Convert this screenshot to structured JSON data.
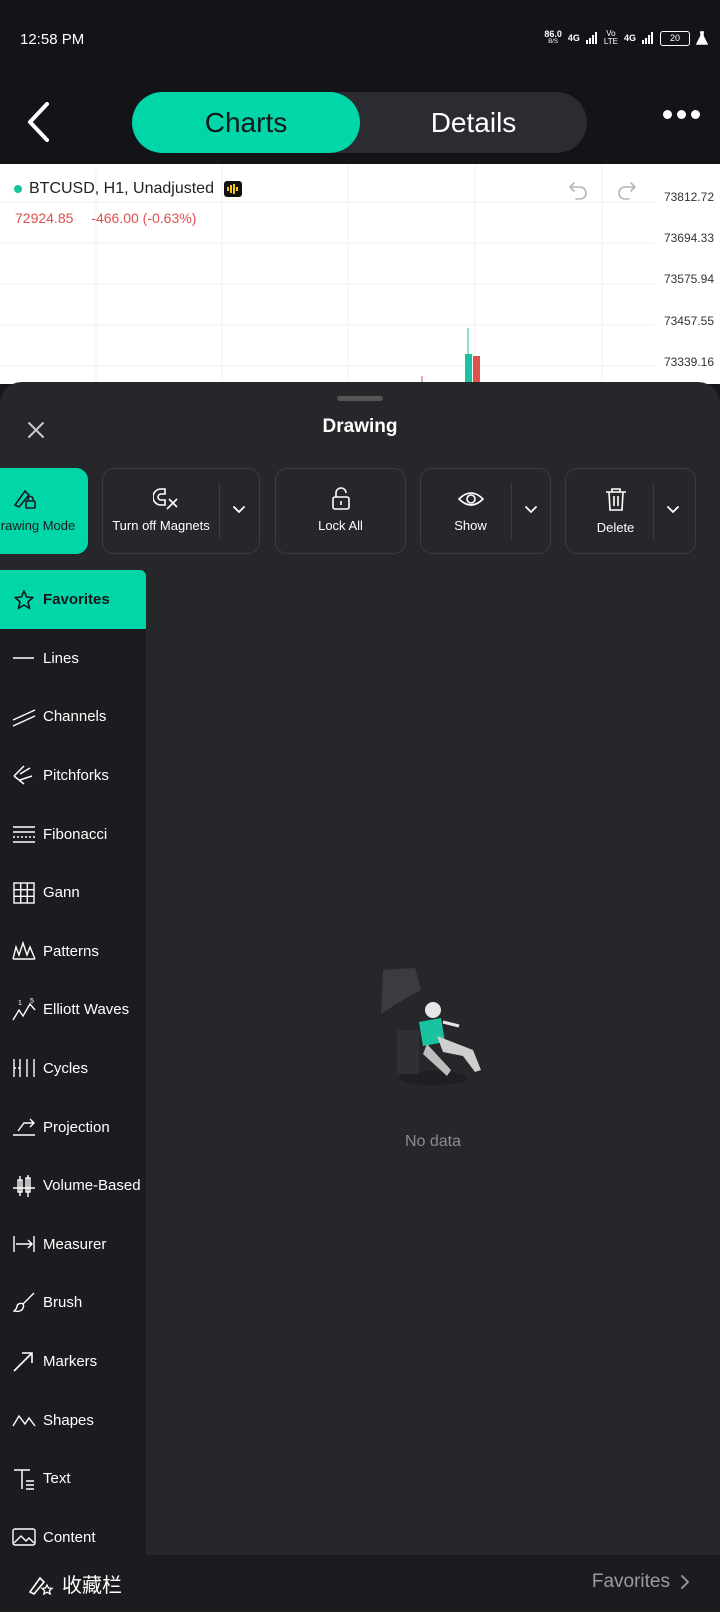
{
  "status": {
    "time": "12:58 PM",
    "speed": "86.0",
    "speed_unit": "B/S",
    "net1": "4G",
    "volte_top": "Vo",
    "volte_bottom": "LTE",
    "net2": "4G",
    "battery": "20"
  },
  "header": {
    "tabs": [
      {
        "label": "Charts",
        "active": true
      },
      {
        "label": "Details",
        "active": false
      }
    ]
  },
  "chart": {
    "symbol": "BTCUSD, H1, Unadjusted",
    "price": "72924.85",
    "change": "-466.00 (-0.63%)",
    "axis_labels": [
      "73812.72",
      "73694.33",
      "73575.94",
      "73457.55",
      "73339.16"
    ],
    "colors": {
      "up": "#19c3a0",
      "down": "#e0504d"
    }
  },
  "panel": {
    "title": "Drawing",
    "tools": [
      {
        "label": "rawing Mode",
        "icon": "drawing-mode-icon",
        "active": true
      },
      {
        "label": "Turn off Magnets",
        "icon": "magnet-off-icon",
        "dropdown": true
      },
      {
        "label": "Lock All",
        "icon": "lock-icon"
      },
      {
        "label": "Show",
        "icon": "eye-icon",
        "dropdown": true
      },
      {
        "label": "Delete",
        "icon": "trash-icon",
        "dropdown": true
      }
    ],
    "categories": [
      {
        "label": "Favorites",
        "icon": "star-icon",
        "active": true
      },
      {
        "label": "Lines",
        "icon": "line-icon"
      },
      {
        "label": "Channels",
        "icon": "channel-icon"
      },
      {
        "label": "Pitchforks",
        "icon": "pitchfork-icon"
      },
      {
        "label": "Fibonacci",
        "icon": "fibonacci-icon"
      },
      {
        "label": "Gann",
        "icon": "gann-icon"
      },
      {
        "label": "Patterns",
        "icon": "patterns-icon"
      },
      {
        "label": "Elliott Waves",
        "icon": "elliott-waves-icon"
      },
      {
        "label": "Cycles",
        "icon": "cycles-icon"
      },
      {
        "label": "Projection",
        "icon": "projection-icon"
      },
      {
        "label": "Volume-Based",
        "icon": "volume-icon"
      },
      {
        "label": "Measurer",
        "icon": "measurer-icon"
      },
      {
        "label": "Brush",
        "icon": "brush-icon"
      },
      {
        "label": "Markers",
        "icon": "marker-arrow-icon"
      },
      {
        "label": "Shapes",
        "icon": "shapes-icon"
      },
      {
        "label": "Text",
        "icon": "text-icon"
      },
      {
        "label": "Content",
        "icon": "image-icon"
      }
    ],
    "empty_text": "No data",
    "accent": "#00d6a8"
  },
  "bottom": {
    "left_label": "收藏栏",
    "right_label": "Favorites"
  }
}
